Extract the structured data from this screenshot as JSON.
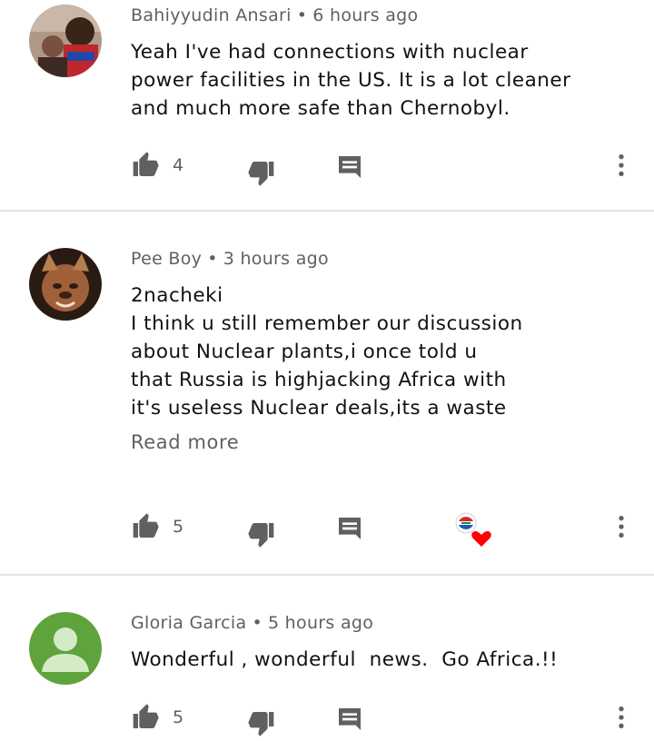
{
  "colors": {
    "text": "#0f0f0f",
    "secondary": "#606060",
    "icon": "#606060",
    "divider": "#e3e3e3",
    "heart": "#ff0000",
    "default_avatar": "#5fa33c"
  },
  "comments": [
    {
      "author": "Bahiyyudin Ansari",
      "time": "6 hours ago",
      "lines": [
        "Yeah I've had connections with nuclear",
        "power facilities in the US. It is a lot cleaner",
        "and much more safe than Chernobyl."
      ],
      "likes": "4"
    },
    {
      "author": "Pee Boy",
      "time": "3 hours ago",
      "lines": [
        "2nacheki",
        "I think u still remember our discussion",
        "about Nuclear plants,i once told u",
        "that Russia is highjacking Africa with",
        "it's useless Nuclear deals,its a waste"
      ],
      "read_more": "Read more",
      "likes": "5",
      "hearted": true
    },
    {
      "author": "Gloria Garcia",
      "time": "5 hours ago",
      "lines": [
        "Wonderful , wonderful  news.  Go Africa.!!"
      ],
      "likes": "5"
    }
  ],
  "separator": "•",
  "icons": [
    "thumb-up-icon",
    "thumb-down-icon",
    "reply-icon",
    "more-vert-icon",
    "heart-icon"
  ]
}
